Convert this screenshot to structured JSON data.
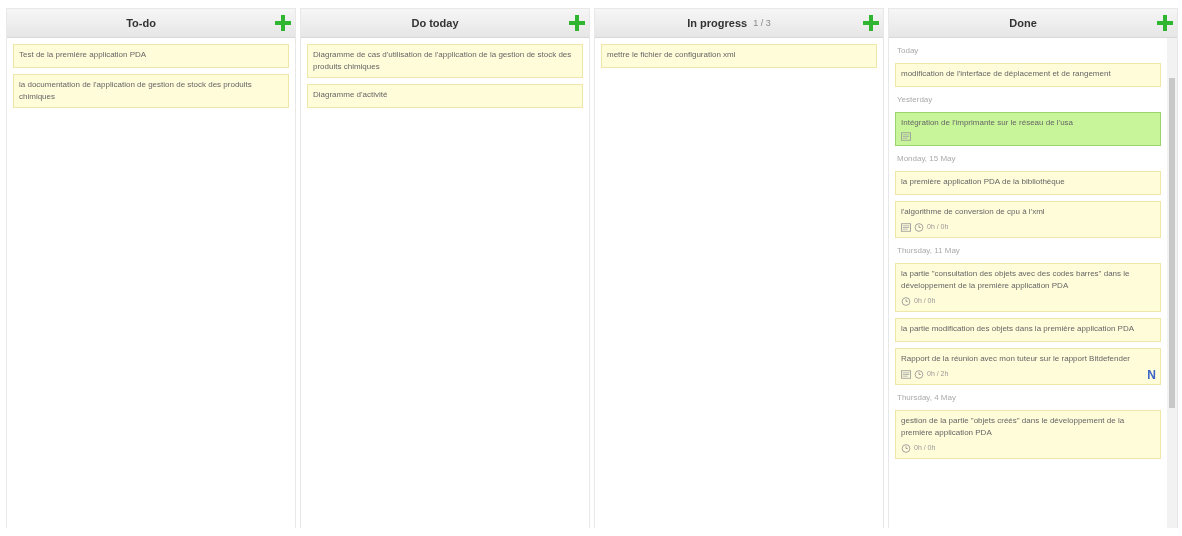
{
  "columns": [
    {
      "title": "To-do",
      "groups": [
        {
          "cards": [
            {
              "text": "Test de la première application PDA",
              "highlighted": false,
              "checklist": false
            },
            {
              "text": "la documentation de l'application de gestion de stock des produits chimiques",
              "highlighted": false,
              "checklist": false
            }
          ]
        }
      ]
    },
    {
      "title": "Do today",
      "groups": [
        {
          "cards": [
            {
              "text": "Diagramme de cas d'utilisation de l'application de la gestion de stock des produits chimiques",
              "highlighted": false,
              "checklist": false
            },
            {
              "text": "Diagramme d'activité",
              "highlighted": false,
              "checklist": false
            }
          ]
        }
      ]
    },
    {
      "title": "In progress",
      "count": "1 / 3",
      "groups": [
        {
          "cards": [
            {
              "text": "mettre le fichier de configuration xml",
              "highlighted": false,
              "checklist": false
            }
          ]
        }
      ]
    },
    {
      "title": "Done",
      "scroll": true,
      "groups": [
        {
          "label": "Today",
          "cards": [
            {
              "text": "modification de l'interface de déplacement et de rangement",
              "highlighted": false,
              "checklist": false
            }
          ]
        },
        {
          "label": "Yesterday",
          "cards": [
            {
              "text": "Intégration de l'imprimante sur le réseau de l'usa",
              "highlighted": true,
              "checklist": true
            }
          ]
        },
        {
          "label": "Monday, 15 May",
          "cards": [
            {
              "text": "la première application PDA de la bibliothèque",
              "highlighted": false,
              "checklist": false
            },
            {
              "text": "l'algorithme de conversion de cpu à l'xml",
              "highlighted": false,
              "checklist": true,
              "time": "0h / 0h"
            }
          ]
        },
        {
          "label": "Thursday, 11 May",
          "cards": [
            {
              "text": "la partie \"consultation des objets avec des codes barres\" dans le développement de la première application PDA",
              "highlighted": false,
              "checklist": false,
              "time": "0h / 0h"
            },
            {
              "text": "la partie modification des objets dans la première application PDA",
              "highlighted": false,
              "checklist": false
            },
            {
              "text": "Rapport de la réunion avec mon tuteur sur le rapport Bitdefender",
              "highlighted": false,
              "checklist": true,
              "time": "0h / 2h",
              "badge": "N"
            }
          ]
        },
        {
          "label": "Thursday, 4 May",
          "cards": [
            {
              "text": "gestion de la partie \"objets créés\" dans le développement de la première application PDA",
              "highlighted": false,
              "checklist": false,
              "time": "0h / 0h"
            }
          ]
        }
      ]
    }
  ]
}
